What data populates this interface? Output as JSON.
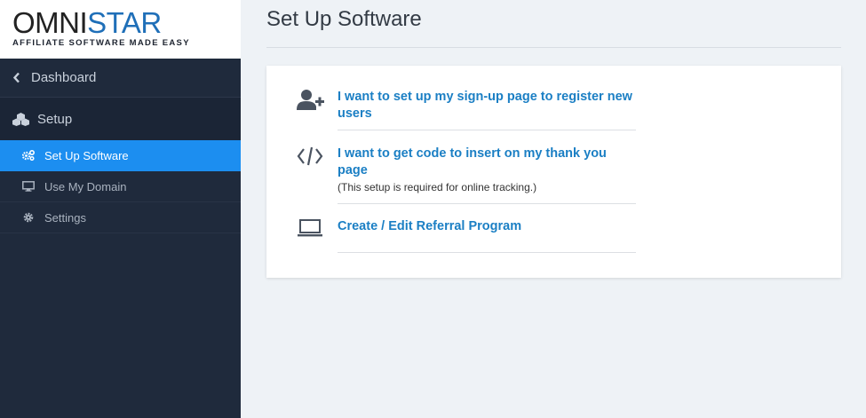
{
  "brand": {
    "logo_main_a": "OMNI",
    "logo_main_b": "STAR",
    "logo_tagline": "AFFILIATE SOFTWARE MADE EASY"
  },
  "sidebar": {
    "dashboard_label": "Dashboard",
    "setup_label": "Setup",
    "items": [
      {
        "label": "Set Up Software",
        "icon": "gears-icon",
        "active": true
      },
      {
        "label": "Use My Domain",
        "icon": "monitor-icon",
        "active": false
      },
      {
        "label": "Settings",
        "icon": "gear-icon",
        "active": false
      }
    ]
  },
  "main": {
    "title": "Set Up Software",
    "options": [
      {
        "label": "I want to set up my sign-up page to register new users",
        "note": "",
        "icon": "add-user-icon"
      },
      {
        "label": "I want to get code to insert on my thank you page",
        "note": "(This setup is required for online tracking.)",
        "icon": "code-icon"
      },
      {
        "label": "Create / Edit Referral Program",
        "note": "",
        "icon": "laptop-icon"
      }
    ]
  },
  "colors": {
    "sidebar_bg": "#1f2a3c",
    "active_bg": "#1c8ef0",
    "link": "#1b7fc4",
    "page_bg": "#eef2f6"
  }
}
